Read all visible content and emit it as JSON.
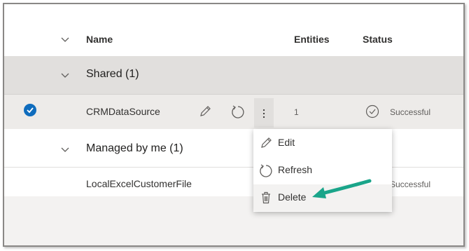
{
  "header": {
    "name": "Name",
    "entities": "Entities",
    "status": "Status"
  },
  "groups": [
    {
      "label": "Shared (1)"
    },
    {
      "label": "Managed by me (1)"
    }
  ],
  "rows": [
    {
      "name": "CRMDataSource",
      "entities": "1",
      "status": "Successful",
      "selected": true
    },
    {
      "name": "LocalExcelCustomerFile",
      "status": "Successful"
    }
  ],
  "context_menu": {
    "items": [
      {
        "label": "Edit"
      },
      {
        "label": "Refresh"
      },
      {
        "label": "Delete"
      }
    ]
  },
  "colors": {
    "accent": "#0f6cbd",
    "annotation_arrow": "#1aa58a"
  },
  "icons": [
    "chevron-down-icon",
    "checkmark-circle-icon",
    "edit-icon",
    "refresh-icon",
    "more-icon",
    "delete-icon",
    "annotation-arrow"
  ]
}
